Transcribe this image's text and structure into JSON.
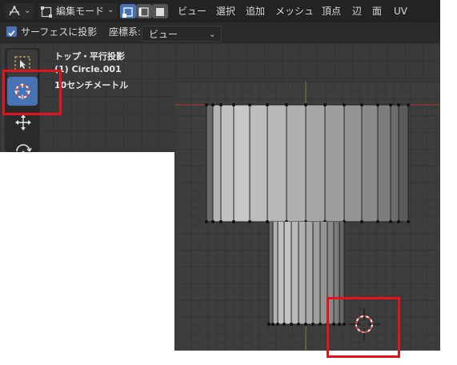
{
  "header": {
    "mode_label": "編集モード",
    "menu": [
      "ビュー",
      "選択",
      "追加",
      "メッシュ",
      "頂点",
      "辺",
      "面",
      "UV"
    ]
  },
  "options": {
    "project_label": "サーフェスに投影",
    "coord_label": "座標系:",
    "coord_value": "ビュー"
  },
  "overlay": {
    "view_name": "トップ・平行投影",
    "object_name": "(1) Circle.001",
    "scale_label": "10センチメートル"
  },
  "icons": {
    "tool_select": "select-box-icon",
    "tool_cursor": "3d-cursor-icon",
    "tool_move": "move-icon",
    "tool_rotate": "rotate-icon",
    "cursor": "3d-cursor-icon"
  },
  "colors": {
    "accent": "#4772b3",
    "highlight": "#e0141a",
    "x_axis": "#a63b3b",
    "y_axis": "#6d8a2a"
  }
}
